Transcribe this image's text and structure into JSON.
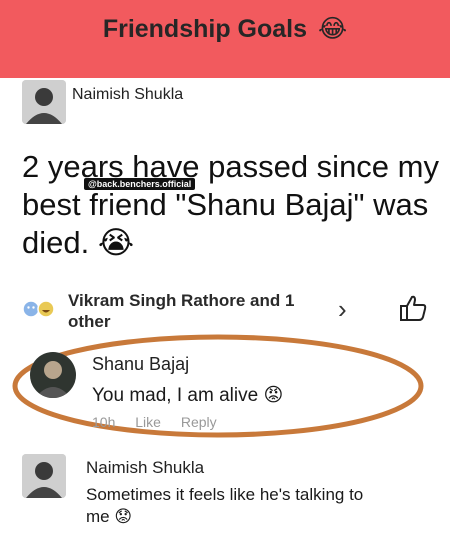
{
  "banner": {
    "title": "Friendship Goals",
    "emoji": "😂",
    "color": "#f25a5e"
  },
  "post": {
    "author": "Naimish Shukla",
    "text": "2 years have passed since my best friend \"Shanu Bajaj\" was died.",
    "emoji": "😭",
    "watermark": "@back.benchers.official"
  },
  "reactions": {
    "icons": [
      "angry-face-icon",
      "laugh-face-icon"
    ],
    "text": "Vikram Singh Rathore and 1 other",
    "chevron": "›"
  },
  "comments": [
    {
      "author": "Shanu Bajaj",
      "text": "You mad, I am alive",
      "emoji": "😡",
      "meta": {
        "time": "10h",
        "like": "Like",
        "reply": "Reply"
      }
    },
    {
      "author": "Naimish Shukla",
      "text": "Sometimes it feels like he's talking to me",
      "emoji": "😟"
    }
  ],
  "highlight_color": "#c8793a"
}
